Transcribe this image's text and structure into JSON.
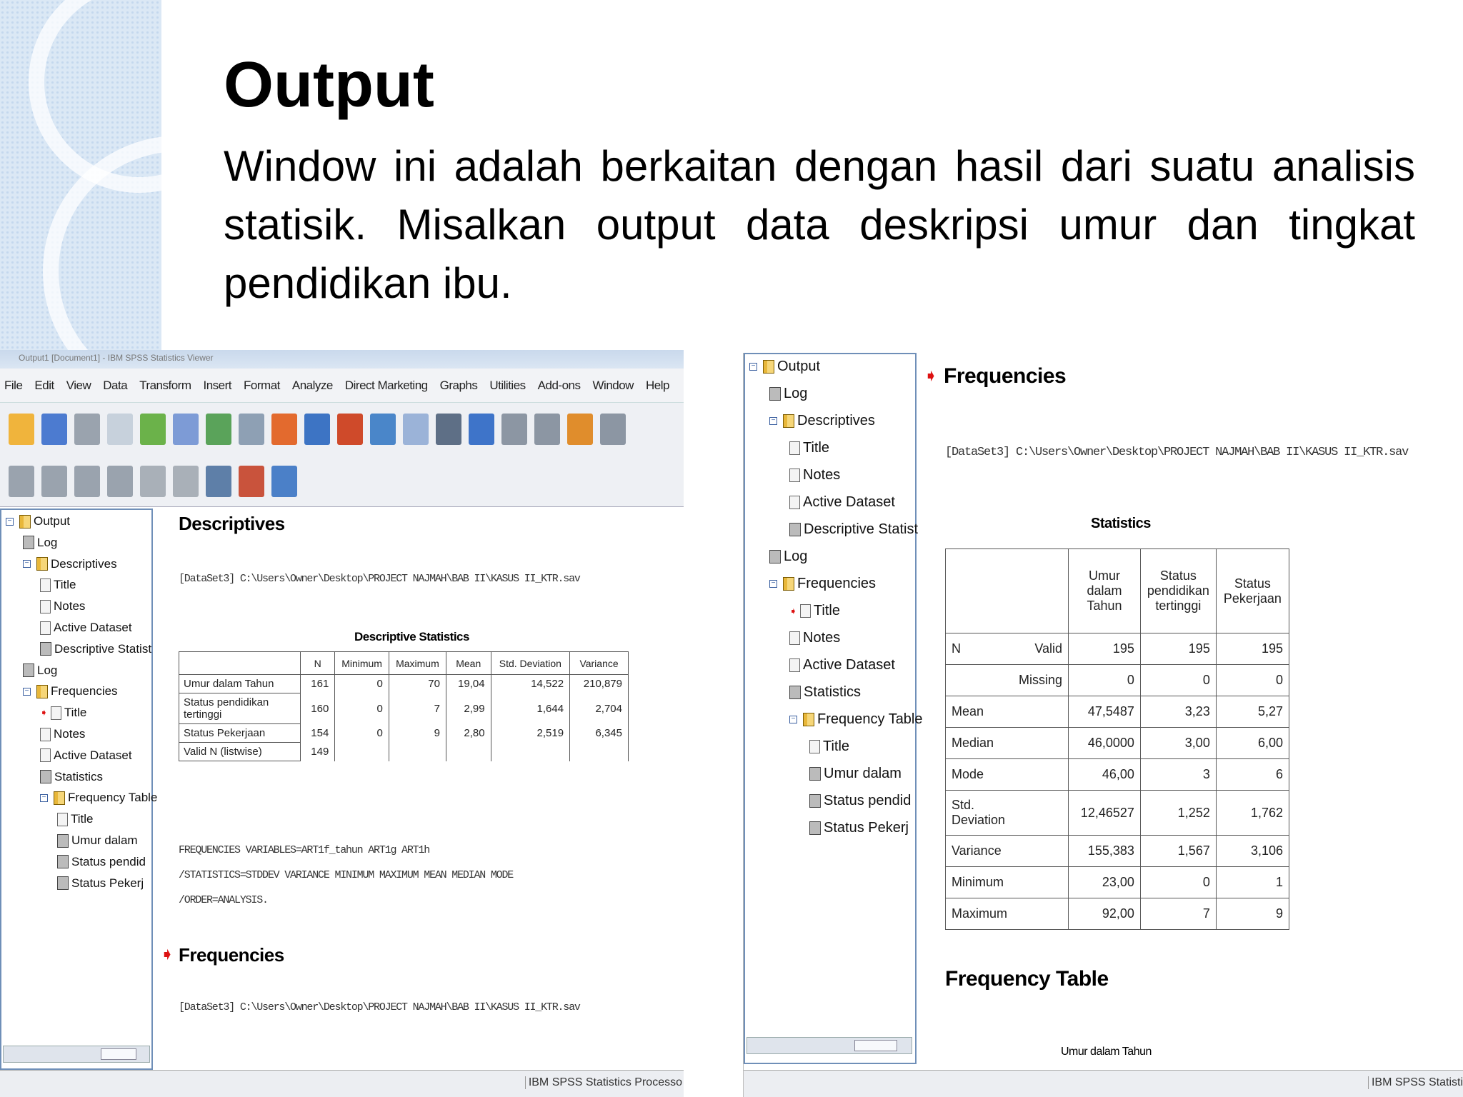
{
  "slide": {
    "title": "Output",
    "body": "Window ini adalah berkaitan dengan hasil dari suatu analisis statisik. Misalkan output data deskripsi umur dan tingkat pendidikan ibu."
  },
  "left_window": {
    "title_bar": "Output1 [Document1] - IBM SPSS Statistics Viewer",
    "menu": [
      "File",
      "Edit",
      "View",
      "Data",
      "Transform",
      "Insert",
      "Format",
      "Analyze",
      "Direct Marketing",
      "Graphs",
      "Utilities",
      "Add-ons",
      "Window",
      "Help"
    ],
    "tree": [
      "Output",
      "Log",
      "Descriptives",
      "Title",
      "Notes",
      "Active Dataset",
      "Descriptive Statist",
      "Log",
      "Frequencies",
      "Title",
      "Notes",
      "Active Dataset",
      "Statistics",
      "Frequency Table",
      "Title",
      "Umur dalam",
      "Status pendid",
      "Status Pekerj"
    ],
    "heading": "Descriptives",
    "dataset_path": "[DataSet3] C:\\Users\\Owner\\Desktop\\PROJECT NAJMAH\\BAB II\\KASUS II_KTR.sav",
    "table_caption": "Descriptive Statistics",
    "table_headers": [
      "",
      "N",
      "Minimum",
      "Maximum",
      "Mean",
      "Std. Deviation",
      "Variance"
    ],
    "table_rows": [
      [
        "Umur dalam Tahun",
        "161",
        "0",
        "70",
        "19,04",
        "14,522",
        "210,879"
      ],
      [
        "Status pendidikan tertinggi",
        "160",
        "0",
        "7",
        "2,99",
        "1,644",
        "2,704"
      ],
      [
        "Status Pekerjaan",
        "154",
        "0",
        "9",
        "2,80",
        "2,519",
        "6,345"
      ],
      [
        "Valid N (listwise)",
        "149",
        "",
        "",
        "",
        "",
        ""
      ]
    ],
    "syntax": [
      "FREQUENCIES VARIABLES=ART1f_tahun ART1g ART1h",
      "  /STATISTICS=STDDEV VARIANCE MINIMUM MAXIMUM MEAN MEDIAN MODE",
      "  /ORDER=ANALYSIS."
    ],
    "heading2": "Frequencies",
    "dataset_path2": "[DataSet3] C:\\Users\\Owner\\Desktop\\PROJECT NAJMAH\\BAB II\\KASUS II_KTR.sav",
    "status_bar": "IBM SPSS Statistics Processo"
  },
  "right_window": {
    "tree": [
      "Output",
      "Log",
      "Descriptives",
      "Title",
      "Notes",
      "Active Dataset",
      "Descriptive Statist",
      "Log",
      "Frequencies",
      "Title",
      "Notes",
      "Active Dataset",
      "Statistics",
      "Frequency Table",
      "Title",
      "Umur dalam",
      "Status pendid",
      "Status Pekerj"
    ],
    "heading": "Frequencies",
    "dataset_path": "[DataSet3] C:\\Users\\Owner\\Desktop\\PROJECT NAJMAH\\BAB II\\KASUS II_KTR.sav",
    "table_caption": "Statistics",
    "table_headers": [
      "Umur dalam Tahun",
      "Status pendidikan tertinggi",
      "Status Pekerjaan"
    ],
    "table_rows": [
      [
        "N",
        "Valid",
        "195",
        "195",
        "195"
      ],
      [
        "",
        "Missing",
        "0",
        "0",
        "0"
      ],
      [
        "Mean",
        "",
        "47,5487",
        "3,23",
        "5,27"
      ],
      [
        "Median",
        "",
        "46,0000",
        "3,00",
        "6,00"
      ],
      [
        "Mode",
        "",
        "46,00",
        "3",
        "6"
      ],
      [
        "Std. Deviation",
        "",
        "12,46527",
        "1,252",
        "1,762"
      ],
      [
        "Variance",
        "",
        "155,383",
        "1,567",
        "3,106"
      ],
      [
        "Minimum",
        "",
        "23,00",
        "0",
        "1"
      ],
      [
        "Maximum",
        "",
        "92,00",
        "7",
        "9"
      ]
    ],
    "heading2": "Frequency Table",
    "subcaption": "Umur dalam Tahun",
    "status_bar": "IBM SPSS Statisti"
  }
}
